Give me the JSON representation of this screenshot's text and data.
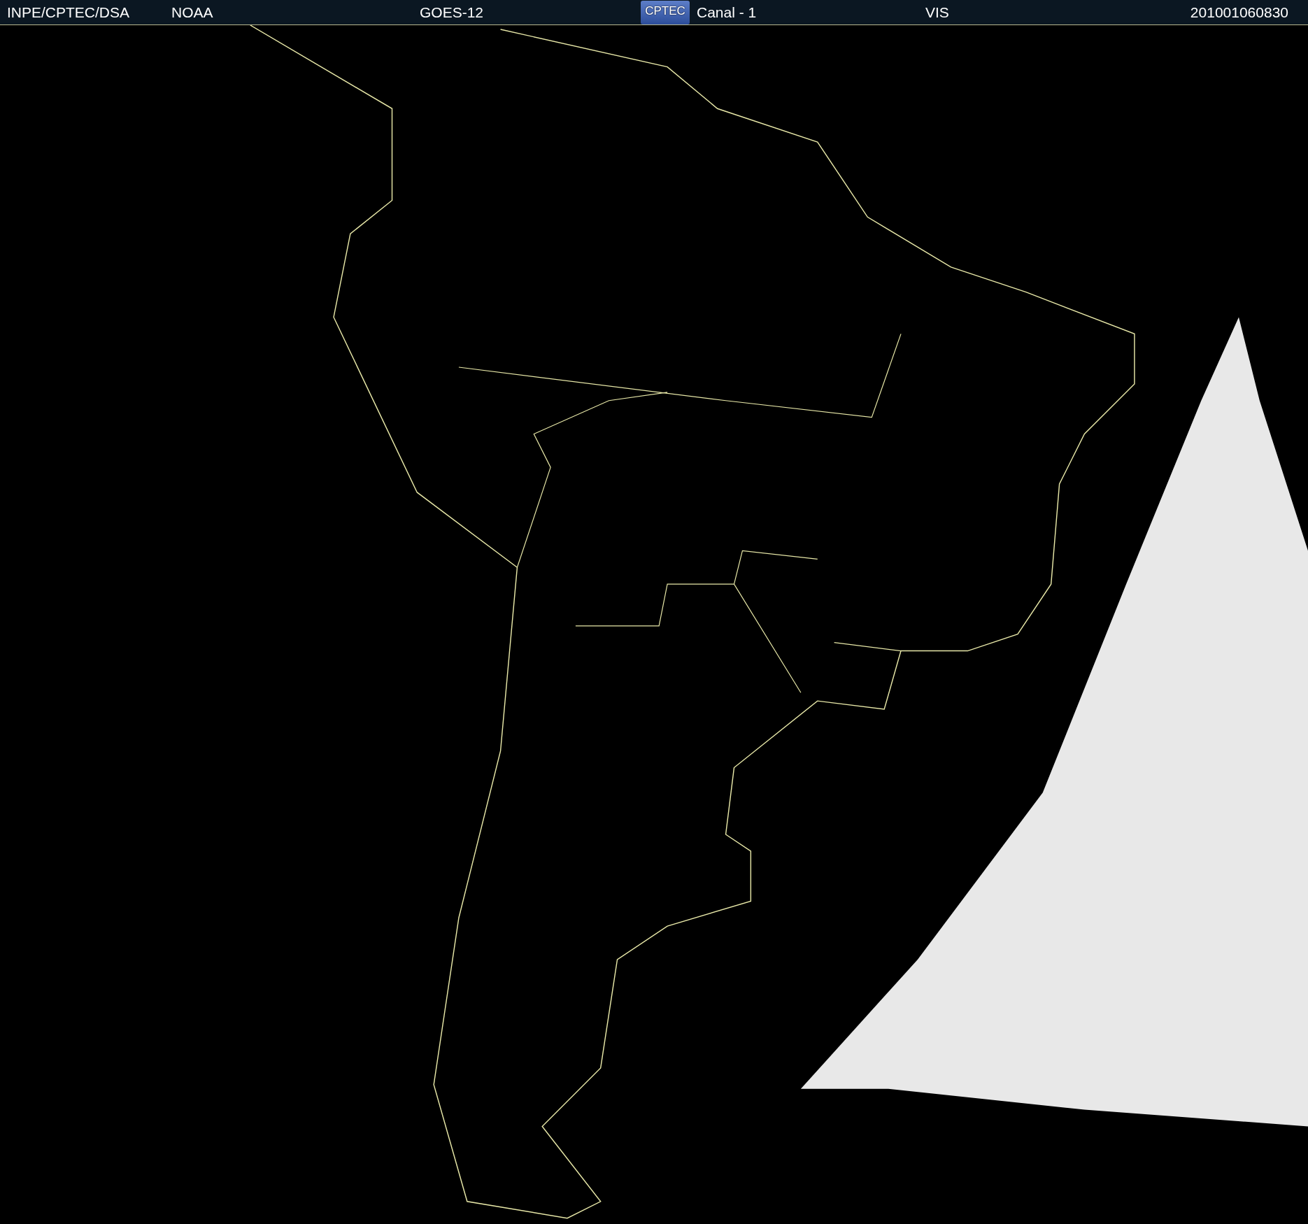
{
  "header": {
    "items": [
      {
        "kind": "text",
        "text": "INPE/CPTEC/DSA"
      },
      {
        "kind": "text",
        "text": "NOAA"
      },
      {
        "kind": "text",
        "text": "GOES-12"
      },
      {
        "kind": "logo",
        "text": "CPTEC"
      },
      {
        "kind": "text",
        "text": "Canal - 1"
      },
      {
        "kind": "text",
        "text": "VIS"
      },
      {
        "kind": "text",
        "text": "201001060830"
      }
    ]
  }
}
